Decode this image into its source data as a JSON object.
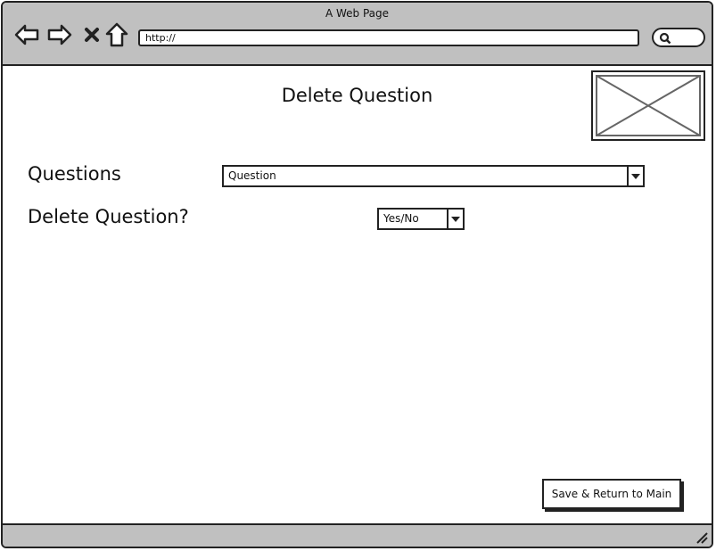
{
  "window": {
    "title": "A Web Page"
  },
  "browser": {
    "url": "http://",
    "nav": {
      "back_icon": "back-arrow-icon",
      "forward_icon": "forward-arrow-icon",
      "stop_icon": "close-icon",
      "home_icon": "home-icon",
      "search_icon": "search-icon"
    }
  },
  "page": {
    "title": "Delete Question",
    "image_placeholder": "image-placeholder",
    "questions_label": "Questions",
    "questions_select": "Question",
    "delete_label": "Delete Question?",
    "delete_select": "Yes/No",
    "save_button": "Save & Return to Main"
  },
  "colors": {
    "chrome": "#c0c0c0",
    "stroke": "#222222"
  }
}
